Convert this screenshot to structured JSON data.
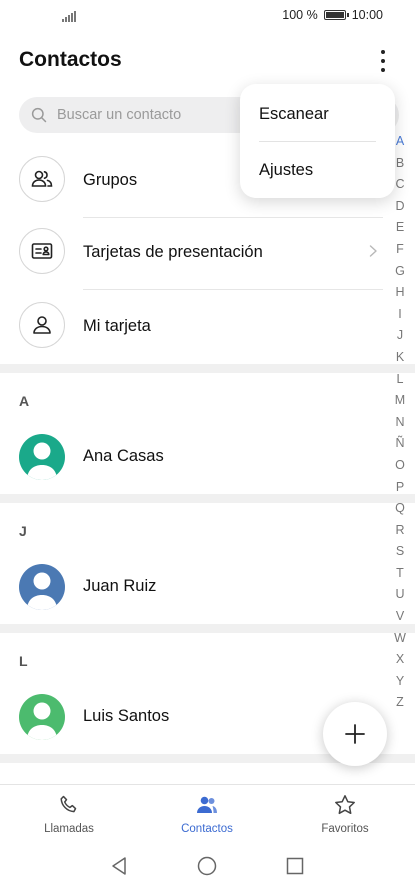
{
  "status_bar": {
    "battery_text": "100 %",
    "time": "10:00"
  },
  "header": {
    "title": "Contactos"
  },
  "search": {
    "placeholder": "Buscar un contacto"
  },
  "menu": {
    "items": [
      "Escanear",
      "Ajustes"
    ]
  },
  "entries": [
    {
      "label": "Grupos",
      "icon": "groups-icon"
    },
    {
      "label": "Tarjetas de presentación",
      "icon": "business-card-icon"
    },
    {
      "label": "Mi tarjeta",
      "icon": "person-icon"
    }
  ],
  "sections": [
    {
      "letter": "A",
      "contact": {
        "name": "Ana Casas",
        "color": "#1aa98a"
      }
    },
    {
      "letter": "J",
      "contact": {
        "name": "Juan Ruiz",
        "color": "#4b79b3"
      }
    },
    {
      "letter": "L",
      "contact": {
        "name": "Luis Santos",
        "color": "#4cbb6e"
      }
    }
  ],
  "alphabet": [
    "A",
    "B",
    "C",
    "D",
    "E",
    "F",
    "G",
    "H",
    "I",
    "J",
    "K",
    "L",
    "M",
    "N",
    "Ñ",
    "O",
    "P",
    "Q",
    "R",
    "S",
    "T",
    "U",
    "V",
    "W",
    "X",
    "Y",
    "Z"
  ],
  "bottom_nav": {
    "tabs": [
      {
        "label": "Llamadas",
        "icon": "phone-icon",
        "active": false
      },
      {
        "label": "Contactos",
        "icon": "contacts-icon",
        "active": true
      },
      {
        "label": "Favoritos",
        "icon": "star-icon",
        "active": false
      }
    ]
  },
  "colors": {
    "accent": "#3c6bd1",
    "divider": "#e6e6e6",
    "section_gap": "#f0f0f0"
  }
}
